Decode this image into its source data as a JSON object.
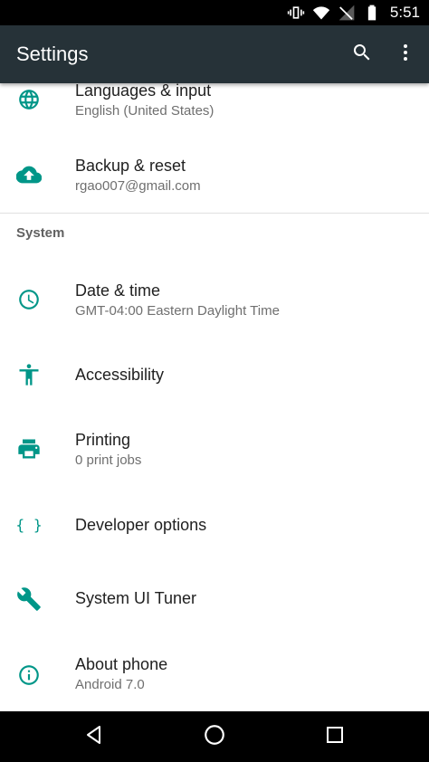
{
  "status_bar": {
    "time": "5:51",
    "icons": [
      "vibrate-icon",
      "wifi-icon",
      "signal-off-icon",
      "battery-icon"
    ]
  },
  "app_bar": {
    "title": "Settings",
    "actions": [
      "search-icon",
      "more-vert-icon"
    ]
  },
  "colors": {
    "app_bar": "#263238",
    "icon_accent": "#009688",
    "status_bar": "#000000"
  },
  "items": [
    {
      "icon": "globe-icon",
      "title": "Languages & input",
      "subtitle": "English (United States)"
    },
    {
      "icon": "cloud-upload-icon",
      "title": "Backup & reset",
      "subtitle": "rgao007@gmail.com"
    },
    {
      "icon": "clock-icon",
      "title": "Date & time",
      "subtitle": "GMT-04:00 Eastern Daylight Time"
    },
    {
      "icon": "accessibility-icon",
      "title": "Accessibility",
      "subtitle": ""
    },
    {
      "icon": "printer-icon",
      "title": "Printing",
      "subtitle": "0 print jobs"
    },
    {
      "icon": "braces-icon",
      "title": "Developer options",
      "subtitle": ""
    },
    {
      "icon": "wrench-icon",
      "title": "System UI Tuner",
      "subtitle": ""
    },
    {
      "icon": "info-icon",
      "title": "About phone",
      "subtitle": "Android 7.0"
    }
  ],
  "section_header": "System",
  "nav_bar": {
    "buttons": [
      "back-icon",
      "home-icon",
      "recents-icon"
    ]
  }
}
